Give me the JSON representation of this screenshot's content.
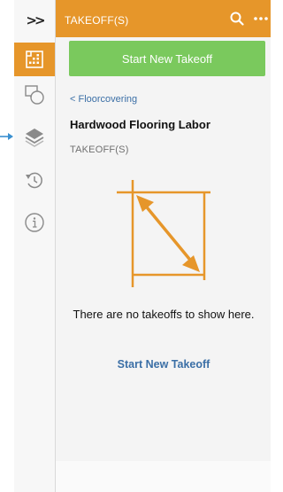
{
  "toolbar": {
    "expand_label": ">>",
    "items": [
      {
        "icon": "takeoff-grid-icon",
        "active": true
      },
      {
        "icon": "shapes-icon",
        "active": false
      },
      {
        "icon": "layers-icon",
        "active": false
      },
      {
        "icon": "history-icon",
        "active": false
      },
      {
        "icon": "info-icon",
        "active": false
      }
    ],
    "pointer_icon": "arrow-right-icon"
  },
  "panel": {
    "header_title": "TAKEOFF(S)",
    "header_icons": [
      "search-icon",
      "more-icon"
    ],
    "primary_button_label": "Start New Takeoff",
    "breadcrumb": "< Floorcovering",
    "item_title": "Hardwood Flooring Labor",
    "section_label": "TAKEOFF(S)",
    "empty_message": "There are no takeoffs to show here.",
    "empty_link_label": "Start New Takeoff"
  },
  "colors": {
    "accent": "#e6962a",
    "primary_button": "#7ac95d",
    "link": "#3b6fa6",
    "pointer": "#3a90d0"
  }
}
